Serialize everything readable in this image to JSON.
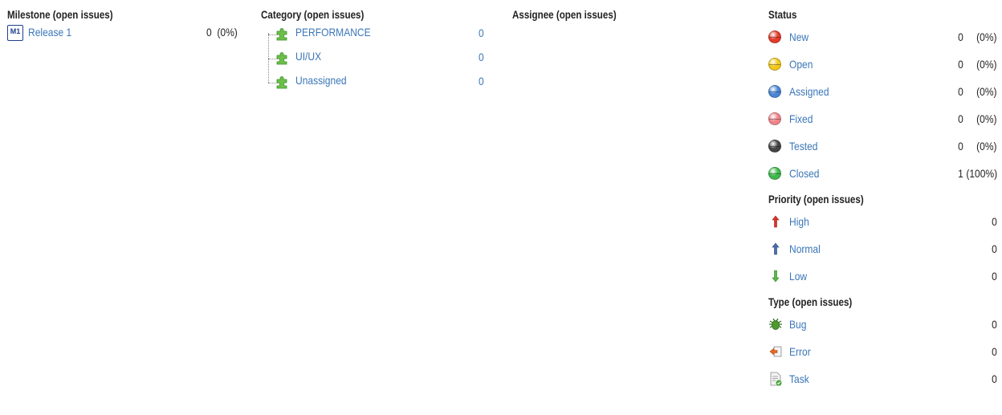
{
  "milestone": {
    "header": "Milestone (open issues)",
    "items": [
      {
        "icon": "milestone-m1-icon",
        "badge": "M1",
        "label": "Release 1",
        "count": "0  (0%)"
      }
    ]
  },
  "category": {
    "header": "Category (open issues)",
    "items": [
      {
        "icon": "puzzle-piece-icon",
        "label": "PERFORMANCE",
        "count": "0"
      },
      {
        "icon": "puzzle-piece-icon",
        "label": "UI/UX",
        "count": "0"
      },
      {
        "icon": "puzzle-piece-icon",
        "label": "Unassigned",
        "count": "0"
      }
    ]
  },
  "assignee": {
    "header": "Assignee (open issues)"
  },
  "status": {
    "header": "Status",
    "items": [
      {
        "label": "New",
        "count": "0",
        "pct": "(0%)",
        "color": "#e53b2c"
      },
      {
        "label": "Open",
        "count": "0",
        "pct": "(0%)",
        "color": "#f2c81a"
      },
      {
        "label": "Assigned",
        "count": "0",
        "pct": "(0%)",
        "color": "#4a86d4"
      },
      {
        "label": "Fixed",
        "count": "0",
        "pct": "(0%)",
        "color": "#f0848a"
      },
      {
        "label": "Tested",
        "count": "0",
        "pct": "(0%)",
        "color": "#444444"
      },
      {
        "label": "Closed",
        "count": "1",
        "pct": "(100%)",
        "color": "#3db94a"
      }
    ]
  },
  "priority": {
    "header": "Priority (open issues)",
    "items": [
      {
        "icon": "arrow-up-red-icon",
        "label": "High",
        "count": "0",
        "color": "#d9342b"
      },
      {
        "icon": "arrow-up-blue-icon",
        "label": "Normal",
        "count": "0",
        "color": "#3b5f9a"
      },
      {
        "icon": "arrow-down-green-icon",
        "label": "Low",
        "count": "0",
        "color": "#4aa83a"
      }
    ]
  },
  "type": {
    "header": "Type (open issues)",
    "items": [
      {
        "icon": "bug-icon",
        "label": "Bug",
        "count": "0"
      },
      {
        "icon": "error-icon",
        "label": "Error",
        "count": "0"
      },
      {
        "icon": "task-icon",
        "label": "Task",
        "count": "0"
      }
    ]
  }
}
